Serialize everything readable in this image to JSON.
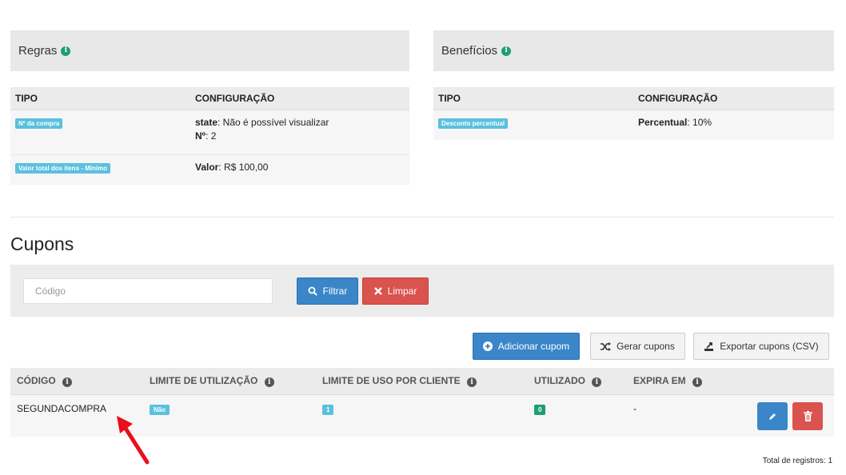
{
  "rules": {
    "title": "Regras",
    "col_tipo": "TIPO",
    "col_config": "CONFIGURAÇÃO",
    "rows": [
      {
        "label": "Nº da compra",
        "k1": "state",
        "v1": ": Não é possível visualizar",
        "k2": "Nº",
        "v2": ": 2"
      },
      {
        "label": "Valor total dos itens - Mínimo",
        "k1": "Valor",
        "v1": ": R$ 100,00"
      }
    ]
  },
  "benefits": {
    "title": "Benefícios",
    "col_tipo": "TIPO",
    "col_config": "CONFIGURAÇÃO",
    "rows": [
      {
        "label": "Desconto percentual",
        "k1": "Percentual",
        "v1": ": 10%"
      }
    ]
  },
  "coupons": {
    "title": "Cupons",
    "search_placeholder": "Código",
    "filter_label": "Filtrar",
    "clear_label": "Limpar",
    "add_label": "Adicionar cupom",
    "generate_label": "Gerar cupons",
    "export_label": "Exportar cupons (CSV)",
    "columns": [
      "CÓDIGO",
      "LIMITE DE UTILIZAÇÃO",
      "LIMITE DE USO POR CLIENTE",
      "UTILIZADO",
      "EXPIRA EM"
    ],
    "rows": [
      {
        "code": "SEGUNDACOMPRA",
        "limit": "Não",
        "per_client": "1",
        "used": "0",
        "expires": "-"
      }
    ],
    "total": "Total de registros: 1"
  },
  "colors": {
    "info_badge": "#5bc0de",
    "success_badge": "#1e9e76",
    "primary": "#3a86c8",
    "danger": "#d9534f",
    "arrow": "#e8101c"
  },
  "icons": [
    "info-icon",
    "search-icon",
    "times-icon",
    "plus-circle-icon",
    "random-icon",
    "export-icon",
    "pencil-icon",
    "trash-icon",
    "arrow-pointer"
  ]
}
